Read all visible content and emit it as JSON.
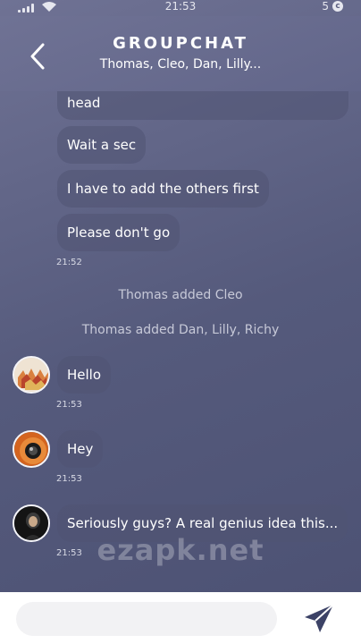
{
  "status_bar": {
    "time": "21:53",
    "notification_count": "5",
    "badge_icon": "c-badge-icon"
  },
  "header": {
    "title": "GROUPCHAT",
    "members": "Thomas, Cleo, Dan, Lilly..."
  },
  "messages": {
    "b1": "head",
    "b2": "Wait a sec",
    "b3": "I have to add the others first",
    "b4": "Please don't go",
    "t1": "21:52",
    "sys1": "Thomas added Cleo",
    "sys2": "Thomas added Dan, Lilly, Richy",
    "m_hello": "Hello",
    "t_hello": "21:53",
    "m_hey": "Hey",
    "t_hey": "21:53",
    "m_genius": "Seriously guys? A real genius idea this...",
    "t_genius": "21:53"
  },
  "watermark": "ezapk.net",
  "input": {
    "placeholder": ""
  },
  "colors": {
    "chat_bg": "#5b5f80",
    "bubble": "#505472",
    "input_bg": "#f2f2f4",
    "send_icon": "#3c4266"
  }
}
